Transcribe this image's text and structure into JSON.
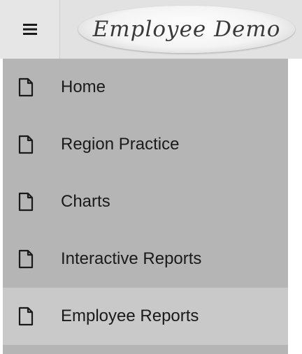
{
  "header": {
    "menu_icon": "hamburger-icon",
    "logo_text": "Employee Demo"
  },
  "nav": {
    "item_icon": "page-icon",
    "items": [
      {
        "label": "Home",
        "active": false
      },
      {
        "label": "Region Practice",
        "active": false
      },
      {
        "label": "Charts",
        "active": false
      },
      {
        "label": "Interactive Reports",
        "active": false
      },
      {
        "label": "Employee Reports",
        "active": true
      }
    ]
  },
  "colors": {
    "header_bg": "#e2e2e2",
    "nav_bg": "#b5b5b5",
    "active_item_bg": "#c9c9c9",
    "text": "#1a1a1a"
  }
}
